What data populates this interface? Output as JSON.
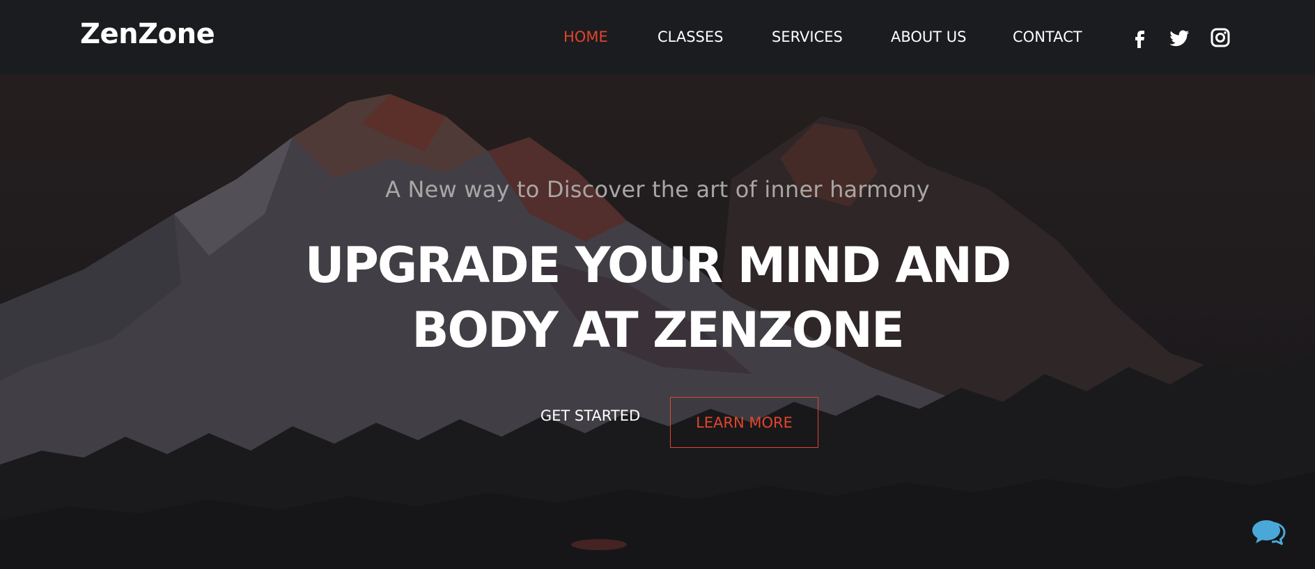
{
  "brand": {
    "logo": "ZenZone"
  },
  "nav": {
    "items": [
      {
        "label": "HOME",
        "active": true
      },
      {
        "label": "CLASSES",
        "active": false
      },
      {
        "label": "SERVICES",
        "active": false
      },
      {
        "label": "ABOUT US",
        "active": false
      },
      {
        "label": "CONTACT",
        "active": false
      }
    ],
    "social": [
      "facebook-icon",
      "twitter-icon",
      "instagram-icon"
    ]
  },
  "hero": {
    "tagline": "A New way to Discover the art of inner harmony",
    "headline_line1": "UPGRADE YOUR MIND AND",
    "headline_line2": "BODY AT ZENZONE",
    "primary_button": "GET STARTED",
    "secondary_button": "LEARN MORE"
  },
  "widgets": {
    "chat": "chat-bubbles-icon"
  },
  "colors": {
    "accent": "#e2452d",
    "header_bg": "#1b1c1f",
    "text": "#ffffff",
    "tagline": "#a9a6a6",
    "chat_icon": "#4aa8d8"
  }
}
